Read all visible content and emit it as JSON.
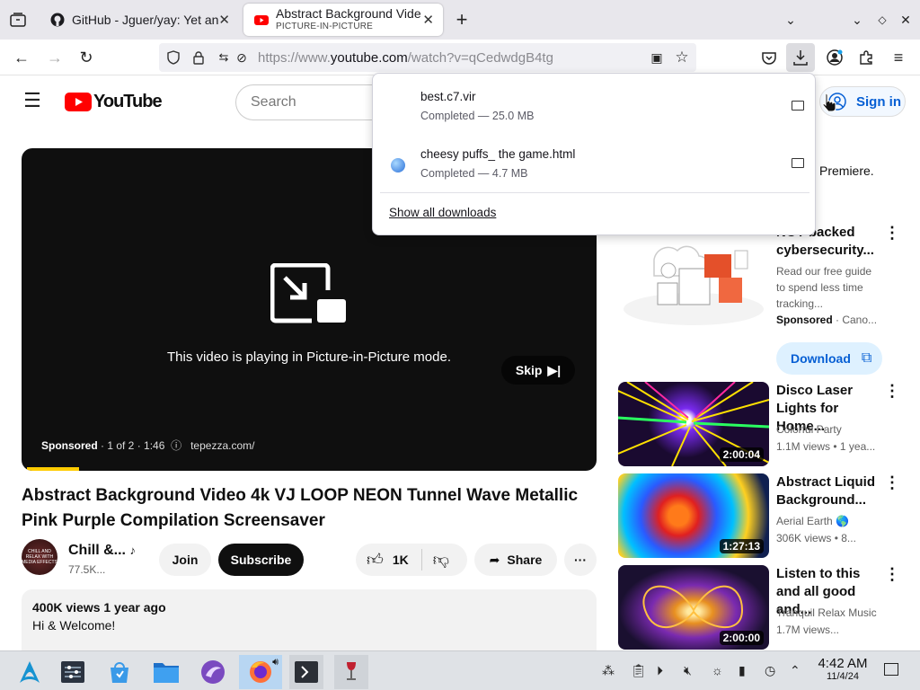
{
  "browser": {
    "tabs": [
      {
        "title": "GitHub - Jguer/yay: Yet an",
        "subtitle": ""
      },
      {
        "title": "Abstract Background Vide",
        "subtitle": "PICTURE-IN-PICTURE"
      }
    ],
    "url_prefix": "https://www.",
    "url_domain": "youtube.com",
    "url_suffix": "/watch?v=qCedwdgB4tg"
  },
  "downloads": {
    "items": [
      {
        "name": "best.c7.vir",
        "status": "Completed — 25.0 MB"
      },
      {
        "name": "cheesy puffs_ the game.html",
        "status": "Completed — 4.7 MB"
      }
    ],
    "show_all": "Show all downloads"
  },
  "youtube": {
    "logo": "YouTube",
    "search_placeholder": "Search",
    "sign_in": "Sign in",
    "player": {
      "pip_message": "This video is playing in Picture-in-Picture mode.",
      "skip": "Skip",
      "sponsored": "Sponsored",
      "ad_info": " · 1 of 2 · 1:46",
      "ad_domain": "tepezza.com/",
      "progress_fraction": 0.09
    },
    "video_title": "Abstract Background Video 4k VJ LOOP NEON Tunnel Wave Metallic Pink Purple Compilation Screensaver",
    "channel": {
      "name": "Chill &...",
      "subscribers": "77.5K...",
      "avatar_text": "CHILL AND RELAX WITH MEDIA EFFECTS"
    },
    "actions": {
      "join": "Join",
      "subscribe": "Subscribe",
      "likes": "1K",
      "share": "Share"
    },
    "description": {
      "stats": "400K views  1 year ago",
      "text": "Hi & Welcome!"
    },
    "sidebar": {
      "premiere_text": "Premiere.",
      "ad": {
        "title": "NOT backed cybersecurity...",
        "desc": "Read our free guide to spend less time tracking...",
        "sponsored": "Sponsored",
        "advertiser": " · Cano...",
        "cta": "Download"
      },
      "videos": [
        {
          "title": "Disco Laser Lights for Home...",
          "channel": "Colorful Party",
          "meta": "1.1M views  • 1 yea...",
          "duration": "2:00:04"
        },
        {
          "title": "Abstract Liquid Background...",
          "channel": "Aerial Earth 🌎",
          "meta": "306K views  • 8...",
          "duration": "1:27:13"
        },
        {
          "title": "Listen to this and all good and...",
          "channel": "Tranquil Relax Music",
          "meta": "1.7M views...",
          "duration": "2:00:00"
        }
      ]
    }
  },
  "taskbar": {
    "time": "4:42 AM",
    "date": "11/4/24"
  }
}
